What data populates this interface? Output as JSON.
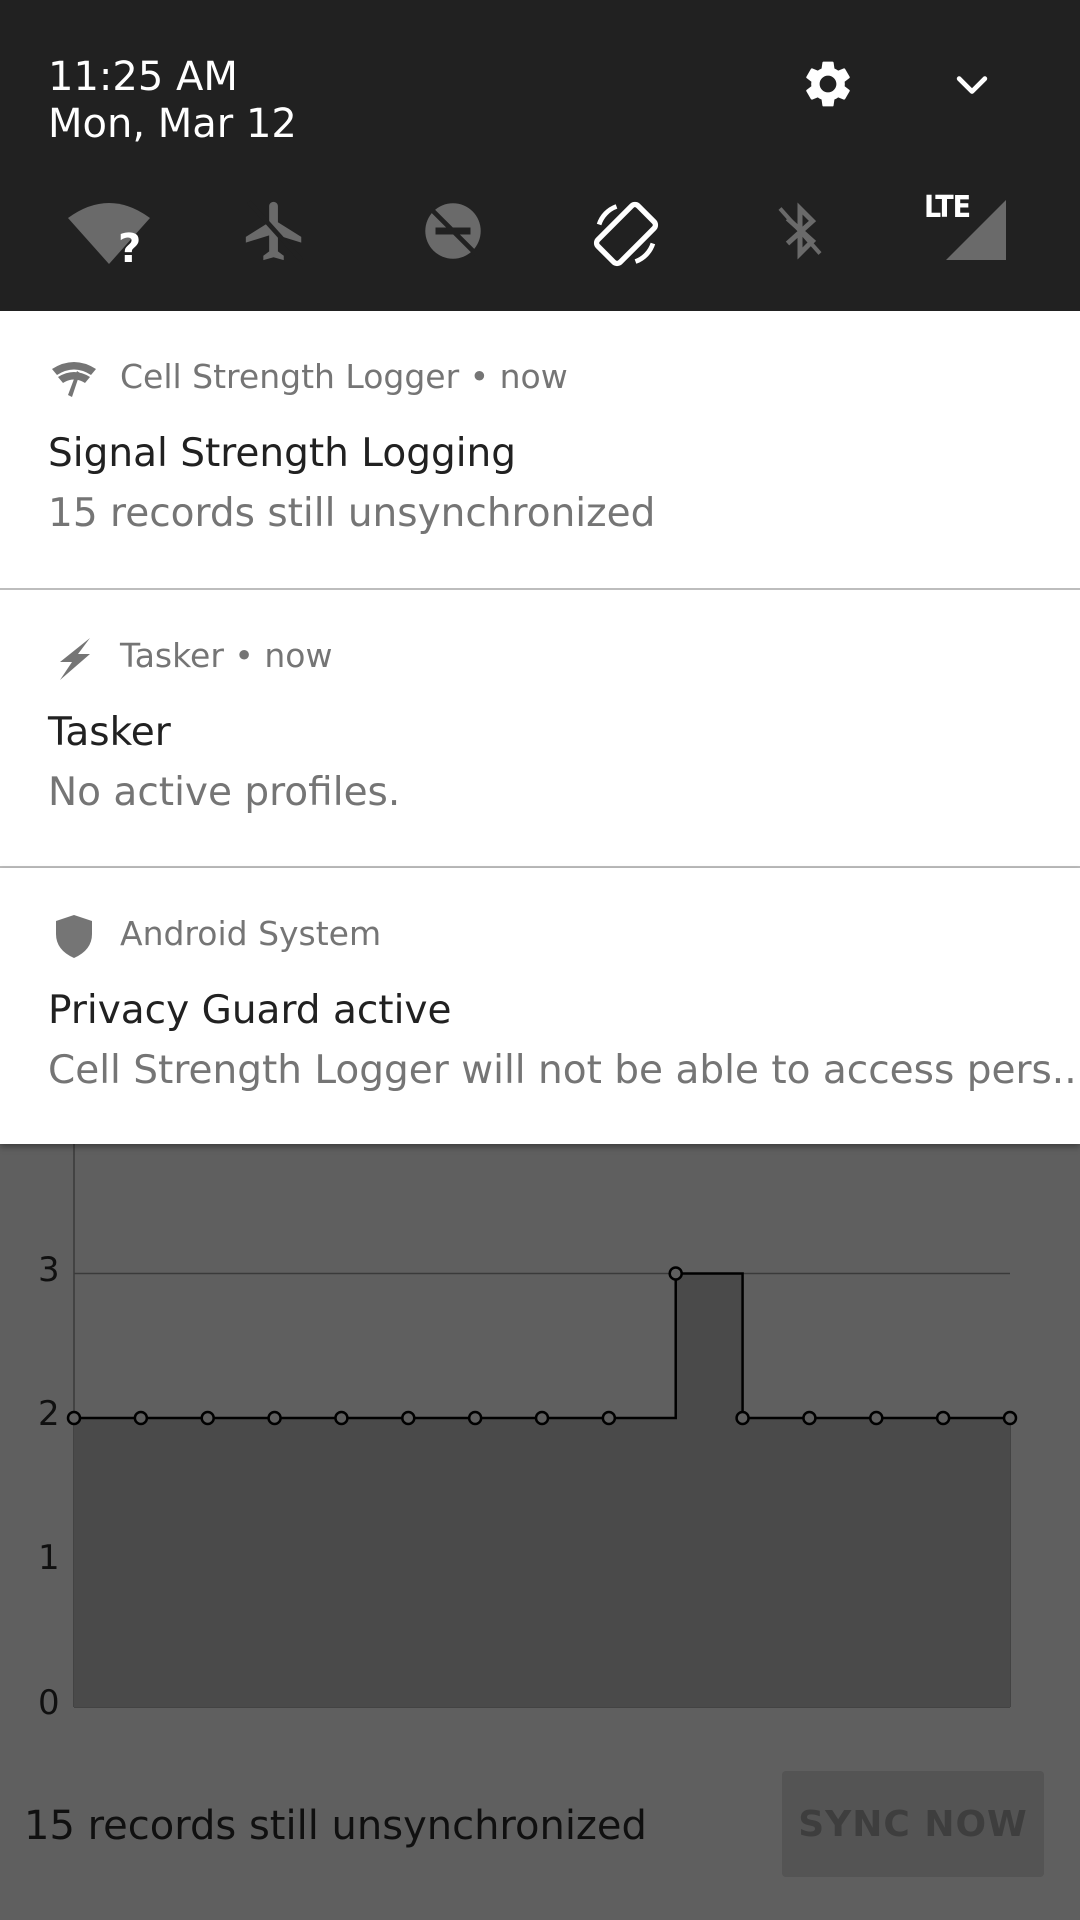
{
  "quick_settings": {
    "time": "11:25 AM",
    "date": "Mon, Mar 12",
    "settings_icon": "gear-icon",
    "expand_icon": "chevron-down-icon",
    "tiles": [
      {
        "name": "wifi-unknown-icon",
        "state": "off"
      },
      {
        "name": "airplane-mode-icon",
        "state": "off"
      },
      {
        "name": "do-not-disturb-icon",
        "state": "off"
      },
      {
        "name": "auto-rotate-icon",
        "state": "on"
      },
      {
        "name": "bluetooth-icon",
        "state": "off"
      },
      {
        "name": "mobile-data-lte-icon",
        "state": "on",
        "label": "LTE"
      }
    ]
  },
  "notifications": [
    {
      "icon": "cell-signal-icon",
      "app": "Cell Strength Logger • now",
      "title": "Signal Strength Logging",
      "text": "15 records still unsynchronized"
    },
    {
      "icon": "bolt-icon",
      "app": "Tasker • now",
      "title": "Tasker",
      "text": "No active profiles."
    },
    {
      "icon": "shield-icon",
      "app": "Android System",
      "title": "Privacy Guard active",
      "text": "Cell Strength Logger will not be able to access pers.."
    }
  ],
  "background_app": {
    "chart_data": {
      "type": "area",
      "y_ticks": [
        "0",
        "1",
        "2",
        "3"
      ],
      "ylim": [
        0,
        3
      ],
      "step": true,
      "x": [
        1,
        2,
        3,
        4,
        5,
        6,
        7,
        8,
        9,
        10,
        11,
        12,
        13,
        14,
        15
      ],
      "values": [
        2,
        2,
        2,
        2,
        2,
        2,
        2,
        2,
        2,
        3,
        2,
        2,
        2,
        2,
        2
      ]
    },
    "footer_text": "15 records still unsynchronized",
    "sync_button": "SYNC NOW"
  },
  "colors": {
    "shade": "#212121",
    "card": "#ffffff",
    "scrim_bg": "#5f5f5f"
  }
}
